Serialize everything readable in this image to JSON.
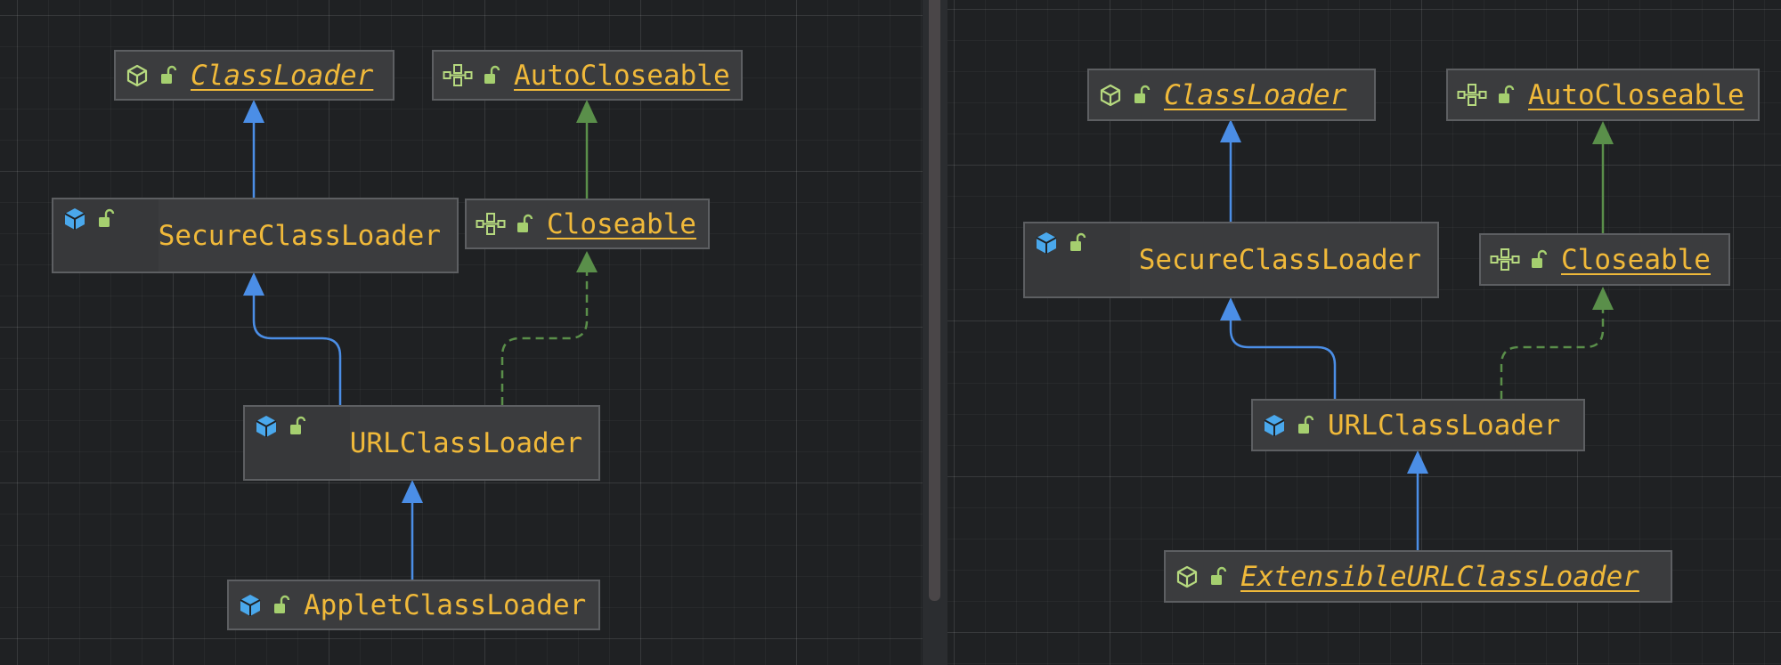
{
  "left_diagram": {
    "nodes": {
      "classloader": {
        "label": "ClassLoader",
        "kind": "abstract-class",
        "icon": "abstract-class-icon"
      },
      "autocloseable": {
        "label": "AutoCloseable",
        "kind": "interface",
        "icon": "interface-icon"
      },
      "secureclassloader": {
        "label": "SecureClassLoader",
        "kind": "class",
        "icon": "class-icon"
      },
      "closeable": {
        "label": "Closeable",
        "kind": "interface",
        "icon": "interface-icon"
      },
      "urlclassloader": {
        "label": "URLClassLoader",
        "kind": "class",
        "icon": "class-icon"
      },
      "appletclassloader": {
        "label": "AppletClassLoader",
        "kind": "class",
        "icon": "class-icon"
      }
    },
    "edges": [
      {
        "from": "secureclassloader",
        "to": "classloader",
        "type": "extends"
      },
      {
        "from": "closeable",
        "to": "autocloseable",
        "type": "extends-interface"
      },
      {
        "from": "urlclassloader",
        "to": "secureclassloader",
        "type": "extends"
      },
      {
        "from": "urlclassloader",
        "to": "closeable",
        "type": "implements"
      },
      {
        "from": "appletclassloader",
        "to": "urlclassloader",
        "type": "extends"
      }
    ]
  },
  "right_diagram": {
    "nodes": {
      "classloader": {
        "label": "ClassLoader",
        "kind": "abstract-class",
        "icon": "abstract-class-icon"
      },
      "autocloseable": {
        "label": "AutoCloseable",
        "kind": "interface",
        "icon": "interface-icon"
      },
      "secureclassloader": {
        "label": "SecureClassLoader",
        "kind": "class",
        "icon": "class-icon"
      },
      "closeable": {
        "label": "Closeable",
        "kind": "interface",
        "icon": "interface-icon"
      },
      "urlclassloader": {
        "label": "URLClassLoader",
        "kind": "class",
        "icon": "class-icon"
      },
      "extensibleurlclassloader": {
        "label": "ExtensibleURLClassLoader",
        "kind": "abstract-class",
        "icon": "abstract-class-icon"
      }
    },
    "edges": [
      {
        "from": "secureclassloader",
        "to": "classloader",
        "type": "extends"
      },
      {
        "from": "closeable",
        "to": "autocloseable",
        "type": "extends-interface"
      },
      {
        "from": "urlclassloader",
        "to": "secureclassloader",
        "type": "extends"
      },
      {
        "from": "urlclassloader",
        "to": "closeable",
        "type": "implements"
      },
      {
        "from": "extensibleurlclassloader",
        "to": "urlclassloader",
        "type": "extends"
      }
    ]
  },
  "colors": {
    "background": "#1f2123",
    "node_fill": "#3b3c3e",
    "node_border": "#5d5f62",
    "label": "#f0b93a",
    "class_icon": "#4aa8ec",
    "interface_icon": "#b6d97f",
    "visibility_icon": "#a5cf6f",
    "extends_edge": "#4b8ee6",
    "implements_edge": "#5a8f4a"
  }
}
